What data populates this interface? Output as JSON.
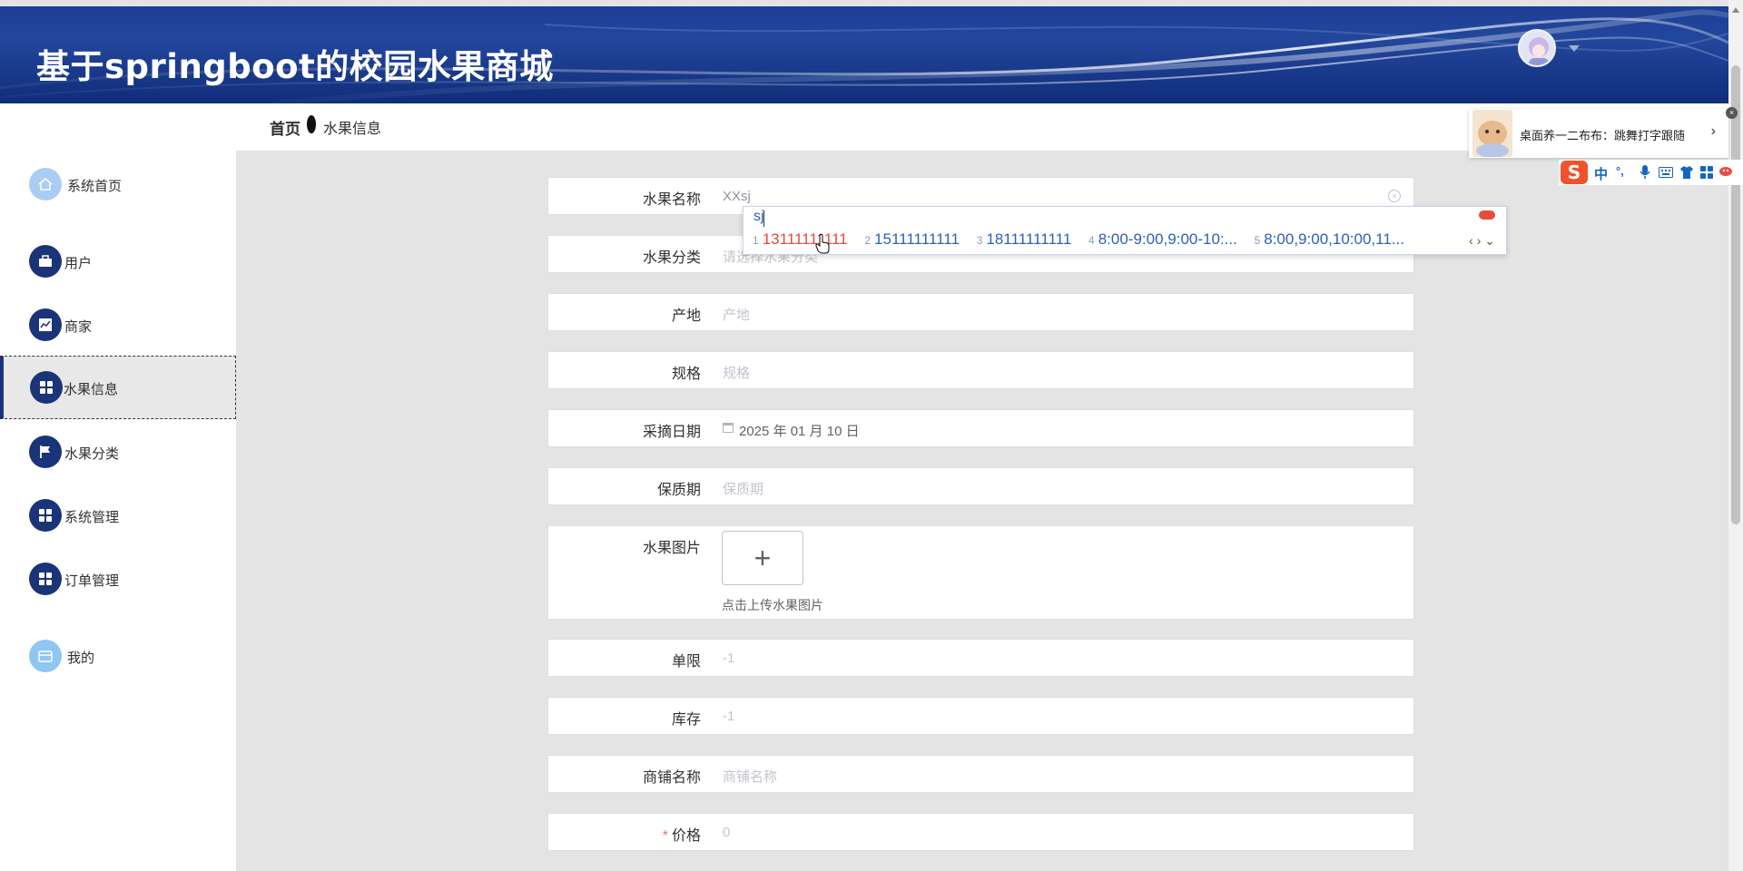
{
  "header": {
    "title": "基于springboot的校园水果商城"
  },
  "breadcrumb": {
    "home": "首页",
    "current": "水果信息"
  },
  "sidebar": {
    "items": [
      {
        "label": "系统首页",
        "icon": "home-icon"
      },
      {
        "label": "用户",
        "icon": "briefcase-icon"
      },
      {
        "label": "商家",
        "icon": "chart-icon"
      },
      {
        "label": "水果信息",
        "icon": "grid-icon",
        "active": true
      },
      {
        "label": "水果分类",
        "icon": "flag-icon"
      },
      {
        "label": "系统管理",
        "icon": "grid-icon"
      },
      {
        "label": "订单管理",
        "icon": "grid-icon"
      },
      {
        "label": "我的",
        "icon": "wallet-icon"
      }
    ]
  },
  "form": {
    "name": {
      "label": "水果名称",
      "value": "XXsj"
    },
    "category": {
      "label": "水果分类",
      "placeholder": "请选择水果分类"
    },
    "origin": {
      "label": "产地",
      "placeholder": "产地"
    },
    "spec": {
      "label": "规格",
      "placeholder": "规格"
    },
    "pick_date": {
      "label": "采摘日期",
      "value": "2025 年 01 月 10 日"
    },
    "shelf_life": {
      "label": "保质期",
      "placeholder": "保质期"
    },
    "image": {
      "label": "水果图片",
      "upload_icon": "+",
      "tip": "点击上传水果图片"
    },
    "limit": {
      "label": "单限",
      "placeholder": "-1"
    },
    "stock": {
      "label": "库存",
      "placeholder": "-1"
    },
    "shop": {
      "label": "商铺名称",
      "placeholder": "商铺名称"
    },
    "price": {
      "label": "价格",
      "required_mark": "*",
      "placeholder": "0"
    }
  },
  "ime": {
    "composition": "sj",
    "candidates": [
      {
        "num": "1",
        "text": "13111111111"
      },
      {
        "num": "2",
        "text": "15111111111"
      },
      {
        "num": "3",
        "text": "18111111111"
      },
      {
        "num": "4",
        "text": "8:00-9:00,9:00-10:..."
      },
      {
        "num": "5",
        "text": "8:00,9:00,10:00,11..."
      }
    ],
    "nav": "‹ › ⌄",
    "toolbar": {
      "logo": "S",
      "mode": "中",
      "punct": "°,",
      "icons": [
        "mic-icon",
        "keyboard-icon",
        "shirt-icon",
        "apps-icon",
        "pet-icon"
      ]
    }
  },
  "notice": {
    "text": "桌面养一二布布：跳舞打字跟随",
    "chevron": "›",
    "close": "×"
  },
  "colors": {
    "header_blue": "#1c3f95",
    "icon_navy": "#1a3479",
    "icon_light": "#a9cdf3",
    "required": "#f56c6c",
    "ime_blue": "#2c5fb8",
    "ime_red": "#e5493c"
  }
}
